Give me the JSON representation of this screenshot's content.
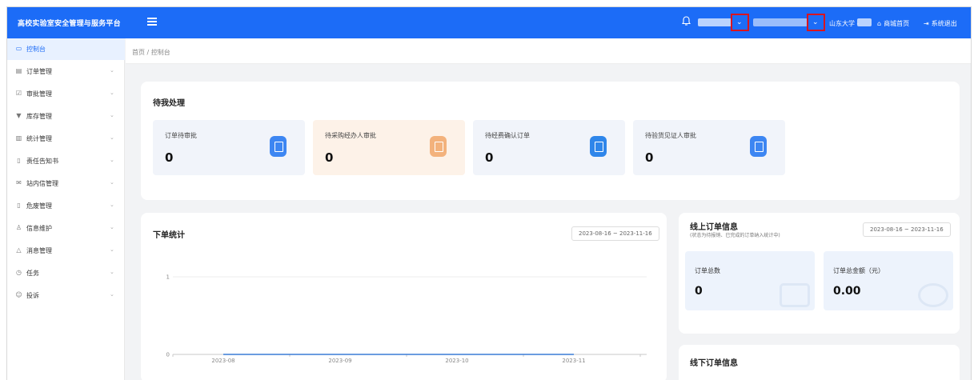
{
  "app": {
    "title": "高校实验室安全管理与服务平台"
  },
  "topbar": {
    "school_label": "山东大学 -",
    "home_label": "商城首页",
    "logout_label": "系统退出"
  },
  "sidebar": {
    "items": [
      {
        "label": "控制台",
        "icon": "monitor-icon",
        "active": true
      },
      {
        "label": "订单管理",
        "icon": "order-icon"
      },
      {
        "label": "审批管理",
        "icon": "approval-icon"
      },
      {
        "label": "库存管理",
        "icon": "inventory-icon"
      },
      {
        "label": "统计管理",
        "icon": "chart-icon"
      },
      {
        "label": "责任告知书",
        "icon": "document-icon"
      },
      {
        "label": "站内信管理",
        "icon": "mail-icon"
      },
      {
        "label": "危废管理",
        "icon": "trash-icon"
      },
      {
        "label": "信息维护",
        "icon": "user-icon"
      },
      {
        "label": "消息管理",
        "icon": "bell-icon"
      },
      {
        "label": "任务",
        "icon": "clock-icon"
      },
      {
        "label": "投诉",
        "icon": "complaint-icon"
      }
    ]
  },
  "breadcrumb": {
    "text": "首页 / 控制台"
  },
  "pending": {
    "title": "待我处理",
    "stats": [
      {
        "label": "订单待审批",
        "value": "0",
        "bg": "#f1f4fa",
        "icon_color": "#3d86f2",
        "icon": "document-icon"
      },
      {
        "label": "待采购经办人审批",
        "value": "0",
        "bg": "#fdf2e8",
        "icon_color": "#f3b27c",
        "icon": "form-icon"
      },
      {
        "label": "待经费确认订单",
        "value": "0",
        "bg": "#f1f4fa",
        "icon_color": "#2f86ea",
        "icon": "upload-icon"
      },
      {
        "label": "待验货见证人审批",
        "value": "0",
        "bg": "#f1f4fa",
        "icon_color": "#3d86f2",
        "icon": "clipboard-icon"
      }
    ]
  },
  "order_stats": {
    "title": "下单统计",
    "date_range": "2023-08-16 ~ 2023-11-16"
  },
  "chart_data": {
    "type": "line",
    "categories": [
      "2023-08",
      "2023-09",
      "2023-10",
      "2023-11"
    ],
    "series": [
      {
        "values": [
          0,
          0,
          0,
          0
        ]
      }
    ],
    "ylim": [
      0,
      1
    ],
    "yticks": [
      "0",
      "1"
    ],
    "grid": true
  },
  "online_orders": {
    "title": "线上订单信息",
    "subtitle": "(状态为待报销、已完成的订单纳入统计中)",
    "date_range": "2023-08-16 ~ 2023-11-16",
    "total_count_label": "订单总数",
    "total_count": "0",
    "total_amount_label": "订单总金额（元）",
    "total_amount": "0.00"
  },
  "offline_orders": {
    "title": "线下订单信息"
  }
}
